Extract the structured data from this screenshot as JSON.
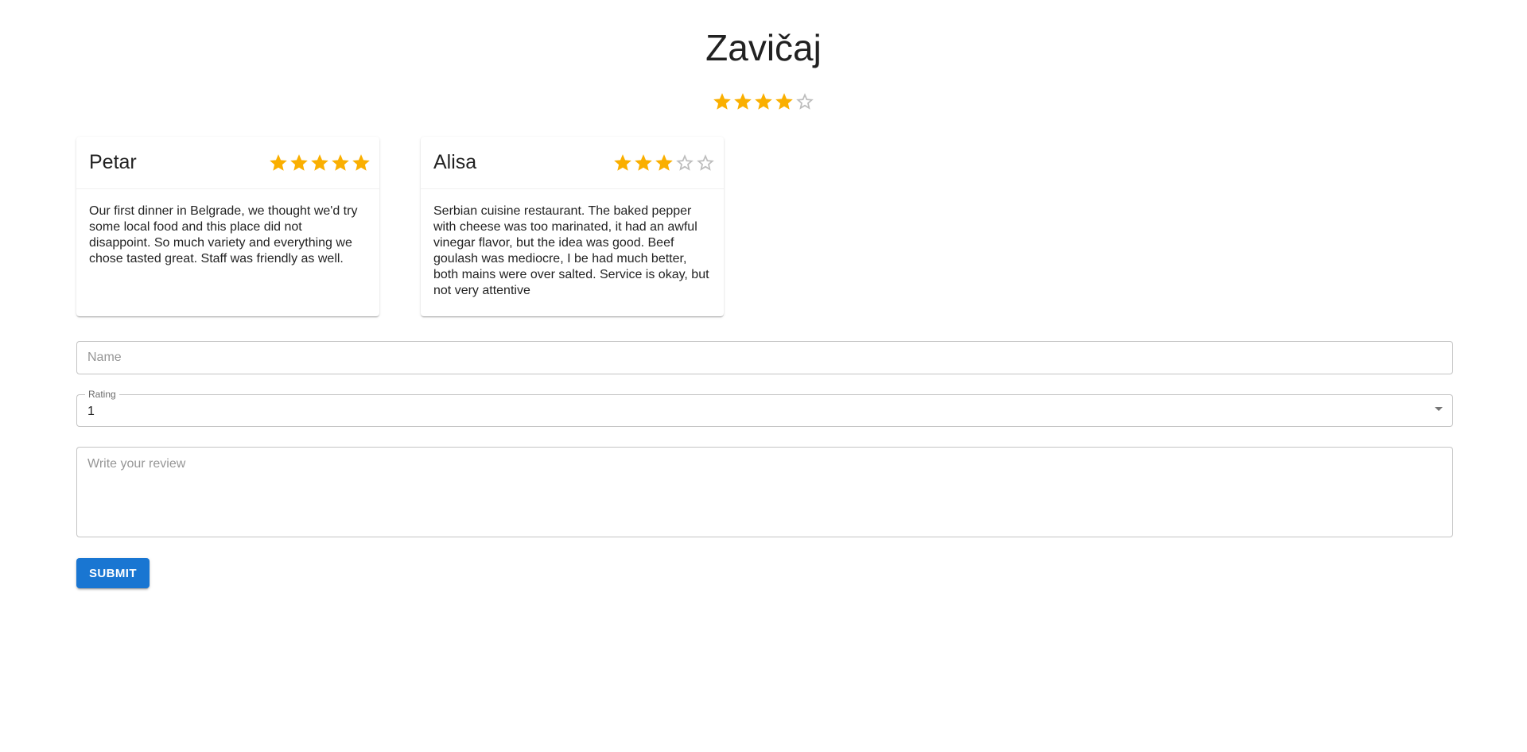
{
  "restaurant": {
    "name": "Zavičaj",
    "rating": 4,
    "max_rating": 5
  },
  "colors": {
    "star_filled": "#faaf00",
    "star_empty": "#bdbdbd",
    "primary": "#1976d2"
  },
  "reviews": [
    {
      "name": "Petar",
      "rating": 5,
      "text": "Our first dinner in Belgrade, we thought we'd try some local food and this place did not disappoint. So much variety and everything we chose tasted great. Staff was friendly as well."
    },
    {
      "name": "Alisa",
      "rating": 3,
      "text": "Serbian cuisine restaurant. The baked pepper with cheese was too marinated, it had an awful vinegar flavor, but the idea was good. Beef goulash was mediocre, I be had much better, both mains were over salted. Service is okay, but not very attentive"
    }
  ],
  "form": {
    "name_placeholder": "Name",
    "rating_label": "Rating",
    "rating_value": "1",
    "review_placeholder": "Write your review",
    "submit_label": "Submit"
  }
}
